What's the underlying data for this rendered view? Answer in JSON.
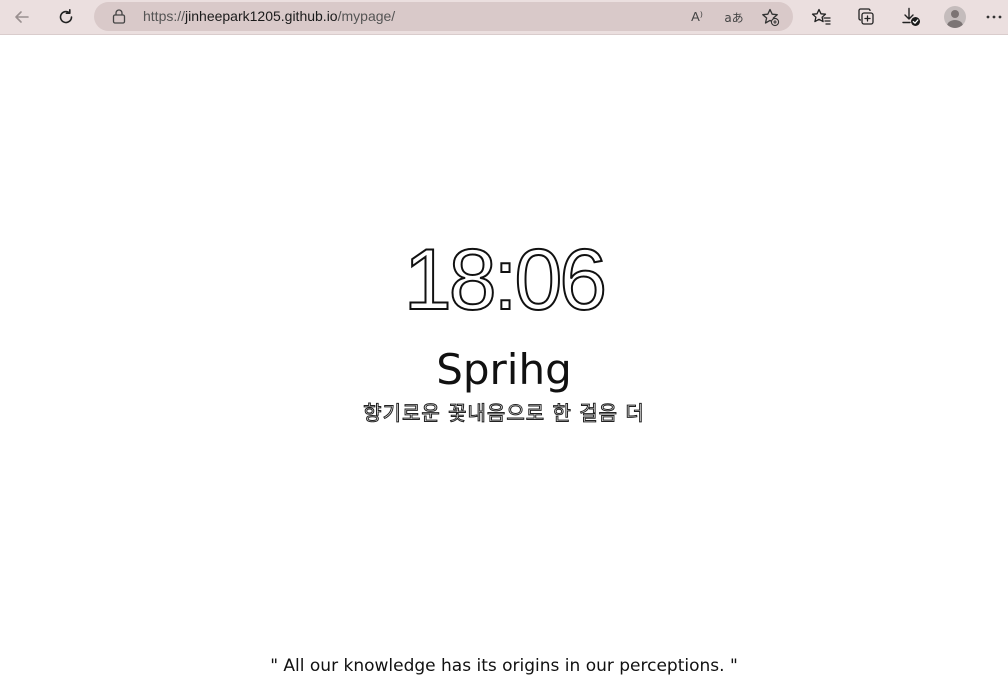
{
  "browser": {
    "url_prefix": "https://",
    "url_host": "jinheepark1205.github.io",
    "url_path": "/mypage/",
    "read_aloud_glyph": "A⁾",
    "translate_glyph": "aあ"
  },
  "page": {
    "clock": "18:06",
    "greeting": "Sprihg",
    "subtitle": "향기로운 꽃내음으로 한 걸음 더",
    "quote": "\" All our knowledge has its origins in our perceptions. \""
  }
}
